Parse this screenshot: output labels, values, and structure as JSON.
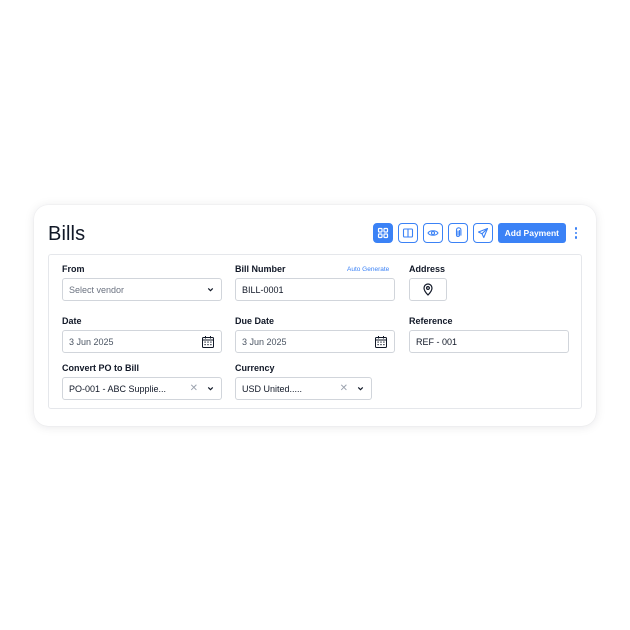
{
  "page": {
    "title": "Bills"
  },
  "toolbar": {
    "buttons": [
      {
        "icon": "grid-icon",
        "active": true
      },
      {
        "icon": "split-view-icon",
        "active": false
      },
      {
        "icon": "eye-icon",
        "active": false
      },
      {
        "icon": "paperclip-icon",
        "active": false
      },
      {
        "icon": "send-icon",
        "active": false
      }
    ],
    "add_payment_label": "Add Payment",
    "more_icon": "kebab-icon",
    "accent": "#3b82f6"
  },
  "form": {
    "from": {
      "label": "From",
      "placeholder": "Select vendor"
    },
    "bill_number": {
      "label": "Bill Number",
      "auto_generate": "Auto Generate",
      "value": "BILL-0001"
    },
    "address": {
      "label": "Address",
      "icon": "map-pin-icon"
    },
    "date": {
      "label": "Date",
      "value": "3 Jun 2025"
    },
    "due_date": {
      "label": "Due Date",
      "value": "3 Jun 2025"
    },
    "reference": {
      "label": "Reference",
      "value": "REF - 001"
    },
    "convert_po": {
      "label": "Convert PO to Bill",
      "value": "PO-001 - ABC Supplie..."
    },
    "currency": {
      "label": "Currency",
      "value": "USD United....."
    }
  }
}
